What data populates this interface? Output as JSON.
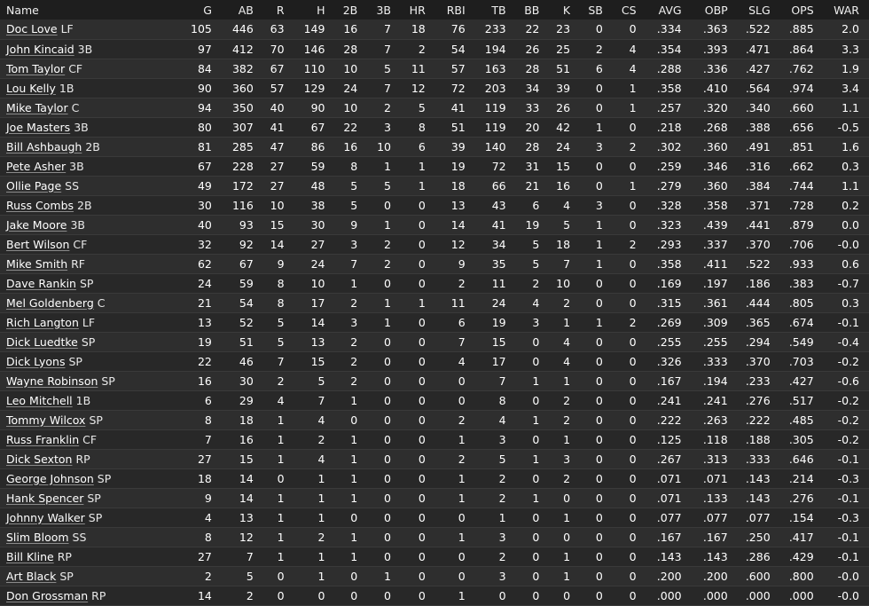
{
  "columns": [
    {
      "key": "name",
      "label": "Name"
    },
    {
      "key": "g",
      "label": "G"
    },
    {
      "key": "ab",
      "label": "AB"
    },
    {
      "key": "r",
      "label": "R"
    },
    {
      "key": "h",
      "label": "H"
    },
    {
      "key": "d2",
      "label": "2B"
    },
    {
      "key": "d3",
      "label": "3B"
    },
    {
      "key": "hr",
      "label": "HR"
    },
    {
      "key": "rbi",
      "label": "RBI"
    },
    {
      "key": "tb",
      "label": "TB"
    },
    {
      "key": "bb",
      "label": "BB"
    },
    {
      "key": "k",
      "label": "K"
    },
    {
      "key": "sb",
      "label": "SB"
    },
    {
      "key": "cs",
      "label": "CS"
    },
    {
      "key": "avg",
      "label": "AVG"
    },
    {
      "key": "obp",
      "label": "OBP"
    },
    {
      "key": "slg",
      "label": "SLG"
    },
    {
      "key": "ops",
      "label": "OPS"
    },
    {
      "key": "war",
      "label": "WAR"
    }
  ],
  "rows": [
    {
      "name": "Doc Love",
      "pos": "LF",
      "stats": [
        "105",
        "446",
        "63",
        "149",
        "16",
        "7",
        "18",
        "76",
        "233",
        "22",
        "23",
        "0",
        "0",
        ".334",
        ".363",
        ".522",
        ".885",
        "2.0"
      ]
    },
    {
      "name": "John Kincaid",
      "pos": "3B",
      "stats": [
        "97",
        "412",
        "70",
        "146",
        "28",
        "7",
        "2",
        "54",
        "194",
        "26",
        "25",
        "2",
        "4",
        ".354",
        ".393",
        ".471",
        ".864",
        "3.3"
      ]
    },
    {
      "name": "Tom Taylor",
      "pos": "CF",
      "stats": [
        "84",
        "382",
        "67",
        "110",
        "10",
        "5",
        "11",
        "57",
        "163",
        "28",
        "51",
        "6",
        "4",
        ".288",
        ".336",
        ".427",
        ".762",
        "1.9"
      ]
    },
    {
      "name": "Lou Kelly",
      "pos": "1B",
      "stats": [
        "90",
        "360",
        "57",
        "129",
        "24",
        "7",
        "12",
        "72",
        "203",
        "34",
        "39",
        "0",
        "1",
        ".358",
        ".410",
        ".564",
        ".974",
        "3.4"
      ]
    },
    {
      "name": "Mike Taylor",
      "pos": "C",
      "stats": [
        "94",
        "350",
        "40",
        "90",
        "10",
        "2",
        "5",
        "41",
        "119",
        "33",
        "26",
        "0",
        "1",
        ".257",
        ".320",
        ".340",
        ".660",
        "1.1"
      ]
    },
    {
      "name": "Joe Masters",
      "pos": "3B",
      "stats": [
        "80",
        "307",
        "41",
        "67",
        "22",
        "3",
        "8",
        "51",
        "119",
        "20",
        "42",
        "1",
        "0",
        ".218",
        ".268",
        ".388",
        ".656",
        "-0.5"
      ]
    },
    {
      "name": "Bill Ashbaugh",
      "pos": "2B",
      "stats": [
        "81",
        "285",
        "47",
        "86",
        "16",
        "10",
        "6",
        "39",
        "140",
        "28",
        "24",
        "3",
        "2",
        ".302",
        ".360",
        ".491",
        ".851",
        "1.6"
      ]
    },
    {
      "name": "Pete Asher",
      "pos": "3B",
      "stats": [
        "67",
        "228",
        "27",
        "59",
        "8",
        "1",
        "1",
        "19",
        "72",
        "31",
        "15",
        "0",
        "0",
        ".259",
        ".346",
        ".316",
        ".662",
        "0.3"
      ]
    },
    {
      "name": "Ollie Page",
      "pos": "SS",
      "stats": [
        "49",
        "172",
        "27",
        "48",
        "5",
        "5",
        "1",
        "18",
        "66",
        "21",
        "16",
        "0",
        "1",
        ".279",
        ".360",
        ".384",
        ".744",
        "1.1"
      ]
    },
    {
      "name": "Russ Combs",
      "pos": "2B",
      "stats": [
        "30",
        "116",
        "10",
        "38",
        "5",
        "0",
        "0",
        "13",
        "43",
        "6",
        "4",
        "3",
        "0",
        ".328",
        ".358",
        ".371",
        ".728",
        "0.2"
      ]
    },
    {
      "name": "Jake Moore",
      "pos": "3B",
      "stats": [
        "40",
        "93",
        "15",
        "30",
        "9",
        "1",
        "0",
        "14",
        "41",
        "19",
        "5",
        "1",
        "0",
        ".323",
        ".439",
        ".441",
        ".879",
        "0.0"
      ]
    },
    {
      "name": "Bert Wilson",
      "pos": "CF",
      "stats": [
        "32",
        "92",
        "14",
        "27",
        "3",
        "2",
        "0",
        "12",
        "34",
        "5",
        "18",
        "1",
        "2",
        ".293",
        ".337",
        ".370",
        ".706",
        "-0.0"
      ]
    },
    {
      "name": "Mike Smith",
      "pos": "RF",
      "stats": [
        "62",
        "67",
        "9",
        "24",
        "7",
        "2",
        "0",
        "9",
        "35",
        "5",
        "7",
        "1",
        "0",
        ".358",
        ".411",
        ".522",
        ".933",
        "0.6"
      ]
    },
    {
      "name": "Dave Rankin",
      "pos": "SP",
      "stats": [
        "24",
        "59",
        "8",
        "10",
        "1",
        "0",
        "0",
        "2",
        "11",
        "2",
        "10",
        "0",
        "0",
        ".169",
        ".197",
        ".186",
        ".383",
        "-0.7"
      ]
    },
    {
      "name": "Mel Goldenberg",
      "pos": "C",
      "stats": [
        "21",
        "54",
        "8",
        "17",
        "2",
        "1",
        "1",
        "11",
        "24",
        "4",
        "2",
        "0",
        "0",
        ".315",
        ".361",
        ".444",
        ".805",
        "0.3"
      ]
    },
    {
      "name": "Rich Langton",
      "pos": "LF",
      "stats": [
        "13",
        "52",
        "5",
        "14",
        "3",
        "1",
        "0",
        "6",
        "19",
        "3",
        "1",
        "1",
        "2",
        ".269",
        ".309",
        ".365",
        ".674",
        "-0.1"
      ]
    },
    {
      "name": "Dick Luedtke",
      "pos": "SP",
      "stats": [
        "19",
        "51",
        "5",
        "13",
        "2",
        "0",
        "0",
        "7",
        "15",
        "0",
        "4",
        "0",
        "0",
        ".255",
        ".255",
        ".294",
        ".549",
        "-0.4"
      ]
    },
    {
      "name": "Dick Lyons",
      "pos": "SP",
      "stats": [
        "22",
        "46",
        "7",
        "15",
        "2",
        "0",
        "0",
        "4",
        "17",
        "0",
        "4",
        "0",
        "0",
        ".326",
        ".333",
        ".370",
        ".703",
        "-0.2"
      ]
    },
    {
      "name": "Wayne Robinson",
      "pos": "SP",
      "stats": [
        "16",
        "30",
        "2",
        "5",
        "2",
        "0",
        "0",
        "0",
        "7",
        "1",
        "1",
        "0",
        "0",
        ".167",
        ".194",
        ".233",
        ".427",
        "-0.6"
      ]
    },
    {
      "name": "Leo Mitchell",
      "pos": "1B",
      "stats": [
        "6",
        "29",
        "4",
        "7",
        "1",
        "0",
        "0",
        "0",
        "8",
        "0",
        "2",
        "0",
        "0",
        ".241",
        ".241",
        ".276",
        ".517",
        "-0.2"
      ]
    },
    {
      "name": "Tommy Wilcox",
      "pos": "SP",
      "stats": [
        "8",
        "18",
        "1",
        "4",
        "0",
        "0",
        "0",
        "2",
        "4",
        "1",
        "2",
        "0",
        "0",
        ".222",
        ".263",
        ".222",
        ".485",
        "-0.2"
      ]
    },
    {
      "name": "Russ Franklin",
      "pos": "CF",
      "stats": [
        "7",
        "16",
        "1",
        "2",
        "1",
        "0",
        "0",
        "1",
        "3",
        "0",
        "1",
        "0",
        "0",
        ".125",
        ".118",
        ".188",
        ".305",
        "-0.2"
      ]
    },
    {
      "name": "Dick Sexton",
      "pos": "RP",
      "stats": [
        "27",
        "15",
        "1",
        "4",
        "1",
        "0",
        "0",
        "2",
        "5",
        "1",
        "3",
        "0",
        "0",
        ".267",
        ".313",
        ".333",
        ".646",
        "-0.1"
      ]
    },
    {
      "name": "George Johnson",
      "pos": "SP",
      "stats": [
        "18",
        "14",
        "0",
        "1",
        "1",
        "0",
        "0",
        "1",
        "2",
        "0",
        "2",
        "0",
        "0",
        ".071",
        ".071",
        ".143",
        ".214",
        "-0.3"
      ]
    },
    {
      "name": "Hank Spencer",
      "pos": "SP",
      "stats": [
        "9",
        "14",
        "1",
        "1",
        "1",
        "0",
        "0",
        "1",
        "2",
        "1",
        "0",
        "0",
        "0",
        ".071",
        ".133",
        ".143",
        ".276",
        "-0.1"
      ]
    },
    {
      "name": "Johnny Walker",
      "pos": "SP",
      "stats": [
        "4",
        "13",
        "1",
        "1",
        "0",
        "0",
        "0",
        "0",
        "1",
        "0",
        "1",
        "0",
        "0",
        ".077",
        ".077",
        ".077",
        ".154",
        "-0.3"
      ]
    },
    {
      "name": "Slim Bloom",
      "pos": "SS",
      "stats": [
        "8",
        "12",
        "1",
        "2",
        "1",
        "0",
        "0",
        "1",
        "3",
        "0",
        "0",
        "0",
        "0",
        ".167",
        ".167",
        ".250",
        ".417",
        "-0.1"
      ]
    },
    {
      "name": "Bill Kline",
      "pos": "RP",
      "stats": [
        "27",
        "7",
        "1",
        "1",
        "1",
        "0",
        "0",
        "0",
        "2",
        "0",
        "1",
        "0",
        "0",
        ".143",
        ".143",
        ".286",
        ".429",
        "-0.1"
      ]
    },
    {
      "name": "Art Black",
      "pos": "SP",
      "stats": [
        "2",
        "5",
        "0",
        "1",
        "0",
        "1",
        "0",
        "0",
        "3",
        "0",
        "1",
        "0",
        "0",
        ".200",
        ".200",
        ".600",
        ".800",
        "-0.0"
      ]
    },
    {
      "name": "Don Grossman",
      "pos": "RP",
      "stats": [
        "14",
        "2",
        "0",
        "0",
        "0",
        "0",
        "0",
        "1",
        "0",
        "0",
        "0",
        "0",
        "0",
        ".000",
        ".000",
        ".000",
        ".000",
        "-0.0"
      ]
    }
  ]
}
